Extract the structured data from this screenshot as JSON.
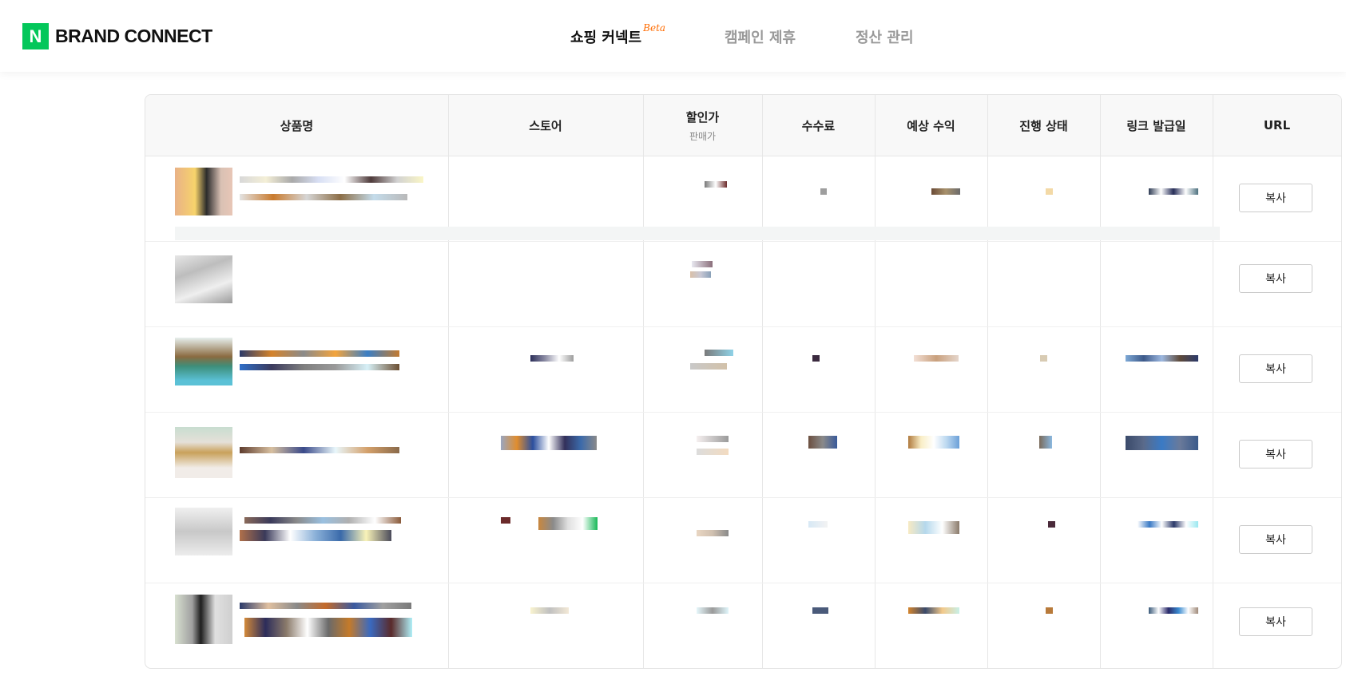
{
  "header": {
    "logo_letter": "N",
    "logo_text": "BRAND CONNECT",
    "nav": [
      {
        "label": "쇼핑 커넥트",
        "badge": "Beta",
        "active": true
      },
      {
        "label": "캠페인 제휴",
        "active": false
      },
      {
        "label": "정산 관리",
        "active": false
      }
    ],
    "brand_color": "#03c75a",
    "badge_color": "#ff6b00"
  },
  "table": {
    "columns": [
      {
        "label": "상품명"
      },
      {
        "label": "스토어"
      },
      {
        "label": "할인가",
        "sub": "판매가"
      },
      {
        "label": "수수료"
      },
      {
        "label": "예상 수익"
      },
      {
        "label": "진행 상태"
      },
      {
        "label": "링크 발급일"
      },
      {
        "label": "URL"
      }
    ],
    "rows": [
      {
        "copy_label": "복사"
      },
      {
        "copy_label": "복사"
      },
      {
        "copy_label": "복사"
      },
      {
        "copy_label": "복사"
      },
      {
        "copy_label": "복사"
      },
      {
        "copy_label": "복사"
      }
    ]
  }
}
